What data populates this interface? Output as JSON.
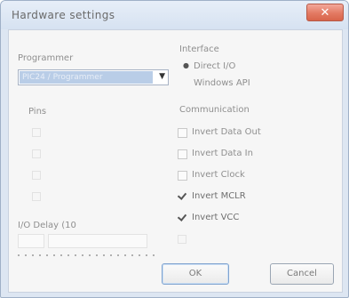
{
  "window": {
    "title": "Hardware settings"
  },
  "titlebar": {
    "close_icon": "close-icon"
  },
  "programmer": {
    "label": "Programmer",
    "selected": "PIC24 / Programmer",
    "dropdown_icon": "chevron-down-icon"
  },
  "interface": {
    "label": "Interface",
    "options": [
      "Direct I/O",
      "Windows API"
    ],
    "selected_index": 0
  },
  "pins": {
    "label": "Pins"
  },
  "communication": {
    "label": "Communication",
    "items": [
      {
        "label": "Invert Data Out",
        "checked": false
      },
      {
        "label": "Invert Data In",
        "checked": false
      },
      {
        "label": "Invert Clock",
        "checked": false
      },
      {
        "label": "Invert MCLR",
        "checked": true
      },
      {
        "label": "Invert VCC",
        "checked": true
      }
    ]
  },
  "io_delay": {
    "label": "I/O Delay (10"
  },
  "buttons": {
    "ok": "OK",
    "cancel": "Cancel"
  }
}
